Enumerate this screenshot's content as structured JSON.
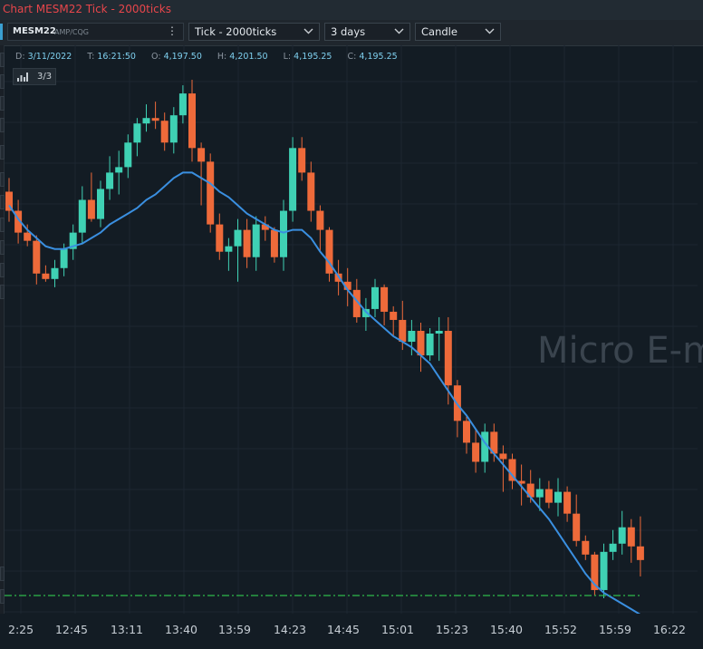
{
  "window": {
    "title": "Chart MESM22 Tick - 2000ticks"
  },
  "toolbar": {
    "symbol": "MESM22",
    "exchange": "AMP/CQG",
    "more_icon": "vertical-ellipsis-icon",
    "interval": "Tick - 2000ticks",
    "range": "3 days",
    "chart_type": "Candle"
  },
  "ohlc": {
    "date_label": "D:",
    "date": "3/11/2022",
    "time_label": "T:",
    "time": "16:21:50",
    "open_label": "O:",
    "open": "4,197.50",
    "high_label": "H:",
    "high": "4,201.50",
    "low_label": "L:",
    "low": "4,195.25",
    "close_label": "C:",
    "close": "4,195.25"
  },
  "layers": {
    "icon": "bar-layers-icon",
    "count": "3/3"
  },
  "watermark": "Micro E-m",
  "colors": {
    "up": "#3fd1b4",
    "down": "#ee6a3a",
    "ma": "#3a8fe0",
    "dash": "#2fb84a",
    "background": "#131c24"
  },
  "time_axis": [
    "2:25",
    "12:45",
    "13:11",
    "13:40",
    "13:59",
    "14:23",
    "14:45",
    "15:01",
    "15:23",
    "15:40",
    "15:52",
    "15:59",
    "16:22"
  ],
  "chart_data": {
    "type": "candlestick",
    "series": [
      {
        "name": "",
        "candles": [
          [
            4233,
            4238,
            4222,
            4226
          ],
          [
            4226,
            4230,
            4214,
            4218
          ],
          [
            4218,
            4221,
            4213,
            4215
          ],
          [
            4215,
            4217,
            4199,
            4203
          ],
          [
            4203,
            4206,
            4200,
            4201
          ],
          [
            4201,
            4208,
            4198,
            4205
          ],
          [
            4205,
            4214,
            4202,
            4212
          ],
          [
            4212,
            4221,
            4208,
            4218
          ],
          [
            4218,
            4235,
            4214,
            4230
          ],
          [
            4230,
            4240,
            4222,
            4223
          ],
          [
            4223,
            4237,
            4220,
            4234
          ],
          [
            4234,
            4246,
            4230,
            4240
          ],
          [
            4240,
            4248,
            4232,
            4242
          ],
          [
            4242,
            4254,
            4238,
            4251
          ],
          [
            4251,
            4260,
            4246,
            4258
          ],
          [
            4258,
            4265,
            4255,
            4260
          ],
          [
            4260,
            4266,
            4256,
            4259
          ],
          [
            4259,
            4262,
            4248,
            4251
          ],
          [
            4251,
            4264,
            4247,
            4261
          ],
          [
            4261,
            4272,
            4258,
            4269
          ],
          [
            4269,
            4274,
            4244,
            4249
          ],
          [
            4249,
            4251,
            4228,
            4244
          ],
          [
            4244,
            4247,
            4218,
            4221
          ],
          [
            4221,
            4225,
            4208,
            4211
          ],
          [
            4211,
            4216,
            4204,
            4213
          ],
          [
            4213,
            4223,
            4200,
            4219
          ],
          [
            4219,
            4223,
            4205,
            4209
          ],
          [
            4209,
            4224,
            4204,
            4221
          ],
          [
            4221,
            4224,
            4215,
            4219
          ],
          [
            4219,
            4220,
            4207,
            4209
          ],
          [
            4209,
            4230,
            4204,
            4226
          ],
          [
            4226,
            4253,
            4222,
            4249
          ],
          [
            4249,
            4253,
            4237,
            4240
          ],
          [
            4240,
            4244,
            4222,
            4226
          ],
          [
            4226,
            4228,
            4211,
            4219
          ],
          [
            4219,
            4220,
            4200,
            4203
          ],
          [
            4203,
            4208,
            4195,
            4200
          ],
          [
            4200,
            4205,
            4191,
            4197
          ],
          [
            4197,
            4201,
            4185,
            4187
          ],
          [
            4187,
            4194,
            4182,
            4190
          ],
          [
            4190,
            4201,
            4187,
            4198
          ],
          [
            4198,
            4199,
            4184,
            4189
          ],
          [
            4189,
            4191,
            4180,
            4186
          ],
          [
            4186,
            4193,
            4175,
            4178
          ],
          [
            4178,
            4186,
            4173,
            4182
          ],
          [
            4182,
            4185,
            4167,
            4173
          ],
          [
            4173,
            4183,
            4171,
            4181
          ],
          [
            4181,
            4187,
            4171,
            4182
          ],
          [
            4182,
            4187,
            4155,
            4162
          ],
          [
            4162,
            4164,
            4143,
            4149
          ],
          [
            4149,
            4151,
            4137,
            4141
          ],
          [
            4141,
            4146,
            4130,
            4134
          ],
          [
            4134,
            4148,
            4130,
            4145
          ],
          [
            4145,
            4148,
            4134,
            4137
          ],
          [
            4137,
            4140,
            4123,
            4135
          ],
          [
            4135,
            4137,
            4124,
            4127
          ],
          [
            4127,
            4133,
            4118,
            4126
          ],
          [
            4126,
            4131,
            4119,
            4121
          ],
          [
            4121,
            4128,
            4116,
            4124
          ],
          [
            4124,
            4127,
            4117,
            4119
          ],
          [
            4119,
            4128,
            4114,
            4123
          ],
          [
            4123,
            4125,
            4112,
            4115
          ],
          [
            4115,
            4122,
            4103,
            4105
          ],
          [
            4105,
            4107,
            4098,
            4100
          ],
          [
            4100,
            4101,
            4085,
            4087
          ],
          [
            4087,
            4104,
            4084,
            4101
          ],
          [
            4101,
            4109,
            4098,
            4104
          ],
          [
            4104,
            4116,
            4100,
            4110
          ],
          [
            4110,
            4113,
            4097,
            4103
          ],
          [
            4103,
            4114,
            4092,
            4098
          ]
        ]
      },
      {
        "name": "",
        "type": "line",
        "values": [
          4228,
          4223,
          4219,
          4216,
          4213,
          4212,
          4212,
          4213,
          4214,
          4216,
          4218,
          4221,
          4223,
          4225,
          4227,
          4230,
          4232,
          4235,
          4238,
          4240,
          4240,
          4238,
          4236,
          4233,
          4231,
          4228,
          4225,
          4223,
          4221,
          4219,
          4218,
          4219,
          4219,
          4216,
          4211,
          4207,
          4202,
          4197,
          4193,
          4189,
          4186,
          4183,
          4180,
          4178,
          4176,
          4173,
          4170,
          4165,
          4160,
          4155,
          4151,
          4146,
          4141,
          4137,
          4133,
          4129,
          4125,
          4121,
          4117,
          4113,
          4108,
          4103,
          4098,
          4093,
          4089,
          4086,
          4084,
          4082,
          4080,
          4078
        ]
      },
      {
        "name": "",
        "type": "horizontal-line",
        "values": [
          4085
        ]
      }
    ],
    "ylim": [
      4083,
      4280
    ]
  }
}
